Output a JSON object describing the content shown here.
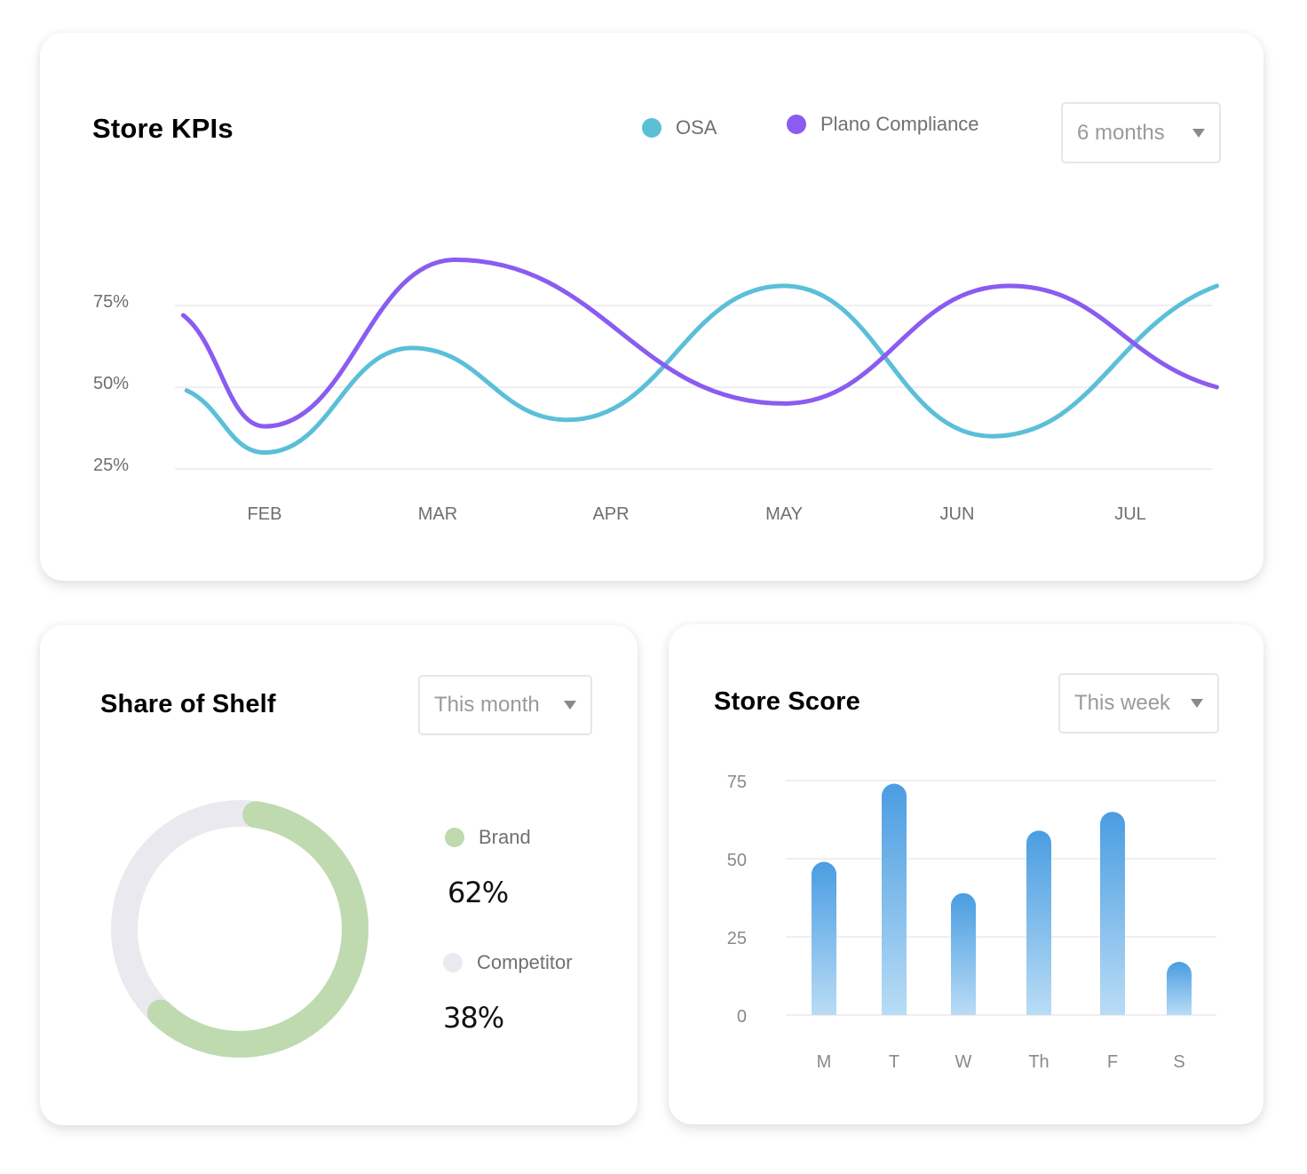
{
  "kpi_card": {
    "title": "Store KPIs",
    "legend": [
      {
        "label": "OSA",
        "color": "#5bbfd8"
      },
      {
        "label": "Plano Compliance",
        "color": "#8a5cf0"
      }
    ],
    "range_dropdown": {
      "value": "6 months"
    }
  },
  "sos_card": {
    "title": "Share of Shelf",
    "range_dropdown": {
      "value": "This month"
    },
    "legend": [
      {
        "label": "Brand",
        "value": "62%",
        "color": "#bfdaaf"
      },
      {
        "label": "Competitor",
        "value": "38%",
        "color": "#ebe9f0"
      }
    ]
  },
  "score_card": {
    "title": "Store Score",
    "range_dropdown": {
      "value": "This week"
    }
  },
  "chart_data": [
    {
      "type": "line",
      "title": "Store KPIs",
      "xlabel": "",
      "ylabel": "",
      "categories": [
        "FEB",
        "MAR",
        "APR",
        "MAY",
        "JUN",
        "JUL"
      ],
      "yticks": [
        "25%",
        "50%",
        "75%"
      ],
      "ylim": [
        25,
        75
      ],
      "grid": true,
      "legend_position": "top-right",
      "series": [
        {
          "name": "OSA",
          "color": "#5bbfd8",
          "points": [
            [
              0.55,
              49
            ],
            [
              1.0,
              30
            ],
            [
              1.85,
              62
            ],
            [
              2.75,
              40
            ],
            [
              4.0,
              81
            ],
            [
              5.2,
              35
            ],
            [
              6.5,
              81
            ]
          ]
        },
        {
          "name": "Plano Compliance",
          "color": "#8a5cf0",
          "points": [
            [
              0.53,
              72
            ],
            [
              1.0,
              38
            ],
            [
              2.1,
              89
            ],
            [
              4.0,
              45
            ],
            [
              5.3,
              81
            ],
            [
              6.5,
              50
            ]
          ]
        }
      ]
    },
    {
      "type": "pie",
      "title": "Share of Shelf",
      "donut": true,
      "categories": [
        "Brand",
        "Competitor"
      ],
      "values": [
        62,
        38
      ],
      "colors": [
        "#bfdaaf",
        "#ebe9f0"
      ],
      "legend_position": "right"
    },
    {
      "type": "bar",
      "title": "Store Score",
      "xlabel": "",
      "ylabel": "",
      "categories": [
        "M",
        "T",
        "W",
        "Th",
        "F",
        "S"
      ],
      "values": [
        49,
        74,
        39,
        59,
        65,
        17
      ],
      "yticks": [
        "0",
        "25",
        "50",
        "75"
      ],
      "ylim": [
        0,
        75
      ],
      "grid": true,
      "colors": {
        "top": "#4a9de2",
        "bottom": "#b9dcf5"
      }
    }
  ]
}
